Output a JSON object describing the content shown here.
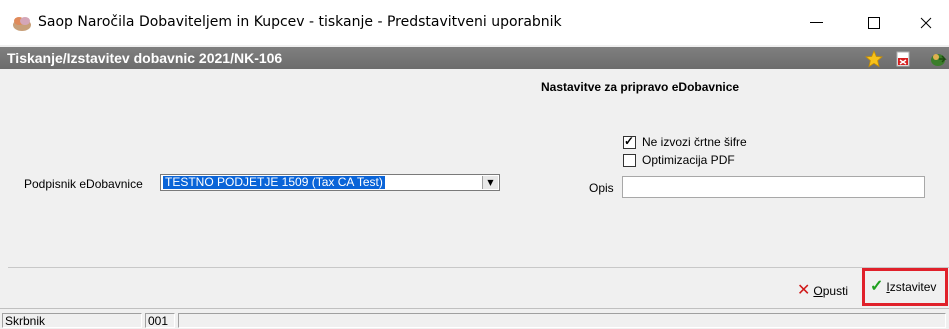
{
  "window": {
    "title": "Saop  Naročila Dobaviteljem in Kupcev - tiskanje - Predstavitveni uporabnik",
    "minimize_symbol": "—",
    "maximize_symbol": "☐",
    "close_symbol": "✕"
  },
  "header": {
    "title": "Tiskanje/Izstavitev dobavnic 2021/NK-106",
    "icons": [
      "star-icon",
      "pdf-icon",
      "exit-icon"
    ]
  },
  "section": {
    "title": "Nastavitve za pripravo eDobavnice"
  },
  "options": {
    "no_dash_codes": {
      "label": "Ne izvozi črtne šifre",
      "checked": true
    },
    "pdf_optimization": {
      "label": "Optimizacija PDF",
      "checked": false
    }
  },
  "signer": {
    "label": "Podpisnik eDobavnice",
    "selected": "TESTNO PODJETJE 1509 (Tax CA Test)"
  },
  "opis": {
    "label": "Opis",
    "value": ""
  },
  "buttons": {
    "cancel_label": "Opusti",
    "cancel_underline": "O",
    "cancel_rest": "pusti",
    "issue_label": "Izstavitev",
    "issue_underline": "I",
    "issue_rest": "zstavitev"
  },
  "statusbar": {
    "user": "Skrbnik",
    "code": "001",
    "info": ""
  },
  "colors": {
    "header_bg": "#737373",
    "selection": "#0a64d8",
    "highlight_border": "#e0202a",
    "cancel_icon": "#d01818",
    "ok_icon": "#1ea01e"
  }
}
